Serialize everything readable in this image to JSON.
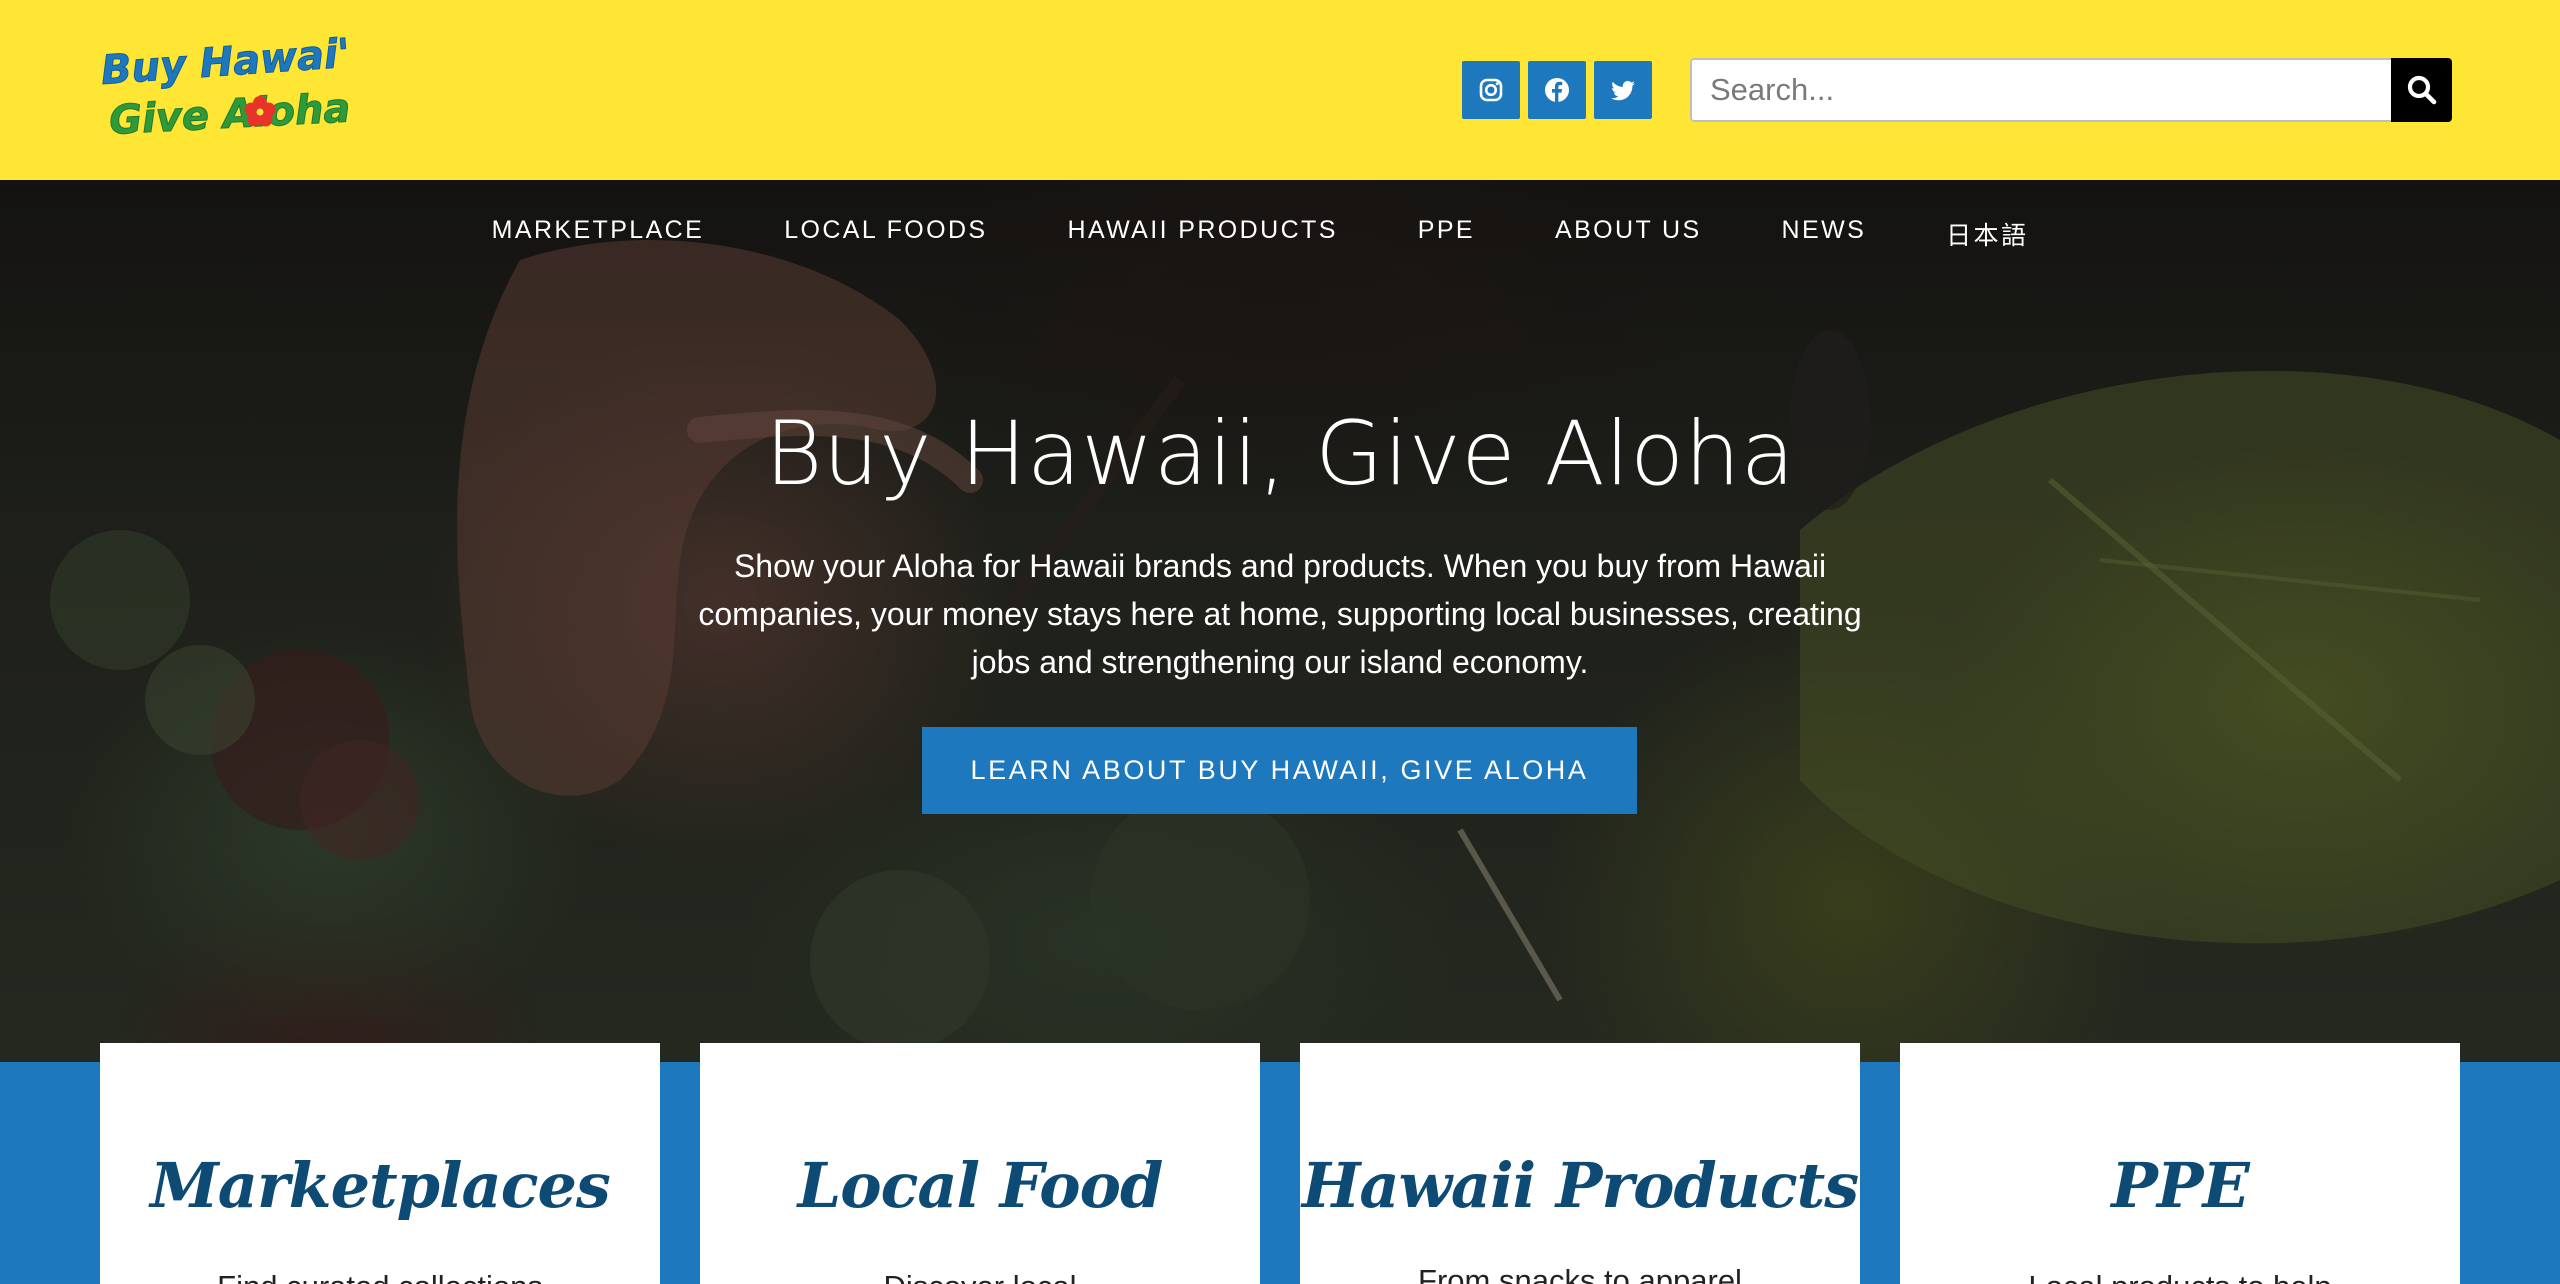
{
  "header": {
    "logo": {
      "line1": "Buy Hawai'i",
      "line2": "Give Aloha",
      "alt": "Buy Hawaii Give Aloha"
    },
    "social": [
      {
        "name": "instagram",
        "icon": "instagram-icon"
      },
      {
        "name": "facebook",
        "icon": "facebook-icon"
      },
      {
        "name": "twitter",
        "icon": "twitter-icon"
      }
    ],
    "search": {
      "placeholder": "Search...",
      "value": "",
      "button_icon": "search-icon"
    }
  },
  "nav": {
    "items": [
      "MARKETPLACE",
      "LOCAL FOODS",
      "HAWAII PRODUCTS",
      "PPE",
      "ABOUT US",
      "NEWS",
      "日本語"
    ]
  },
  "hero": {
    "title": "Buy Hawaii, Give Aloha",
    "text": "Show your Aloha for Hawaii brands and products. When you buy from Hawaii companies, your money stays here at home, supporting local businesses, creating jobs and strengthening our island economy.",
    "cta": "LEARN ABOUT BUY HAWAII, GIVE ALOHA"
  },
  "cards": [
    {
      "title": "Marketplaces",
      "desc": "Find curated collections"
    },
    {
      "title": "Local Food",
      "desc": "Discover local"
    },
    {
      "title": "Hawaii Products",
      "desc": "From snacks to apparel"
    },
    {
      "title": "PPE",
      "desc": "Local products to help"
    }
  ],
  "colors": {
    "header_bg": "#ffe634",
    "brand_blue": "#1e78be",
    "card_title": "#0d4a74",
    "logo_blue": "#1e78be",
    "logo_green": "#2e9a3a",
    "hibiscus_red": "#e8322a"
  }
}
